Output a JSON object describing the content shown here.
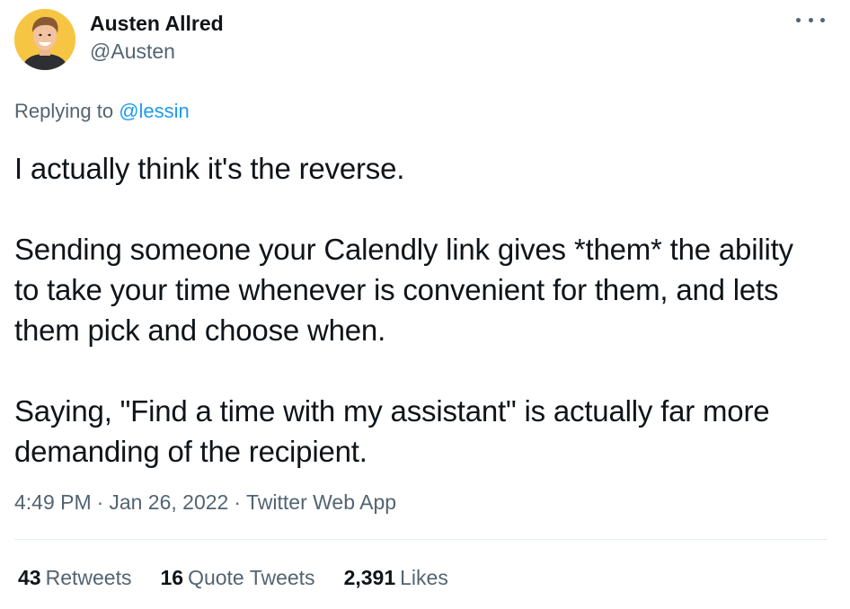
{
  "author": {
    "name": "Austen Allred",
    "handle": "@Austen",
    "avatar_bg": "#f6c544"
  },
  "reply": {
    "prefix": "Replying to",
    "mention": "@lessin"
  },
  "tweet": {
    "text": "I actually think it's the reverse.\n\nSending someone your Calendly link gives *them* the ability to take your time whenever is convenient for them, and lets them pick and choose when.\n\nSaying, \"Find a time with my assistant\" is actually far more demanding of the recipient."
  },
  "meta": {
    "time": "4:49 PM",
    "date": "Jan 26, 2022",
    "source": "Twitter Web App",
    "separator": "·"
  },
  "stats": [
    {
      "count": "43",
      "label": "Retweets"
    },
    {
      "count": "16",
      "label": "Quote Tweets"
    },
    {
      "count": "2,391",
      "label": "Likes"
    }
  ],
  "icons": {
    "more": "more-options-icon"
  },
  "colors": {
    "accent": "#1d9bf0",
    "text": "#0f1419",
    "secondary": "#536471"
  }
}
